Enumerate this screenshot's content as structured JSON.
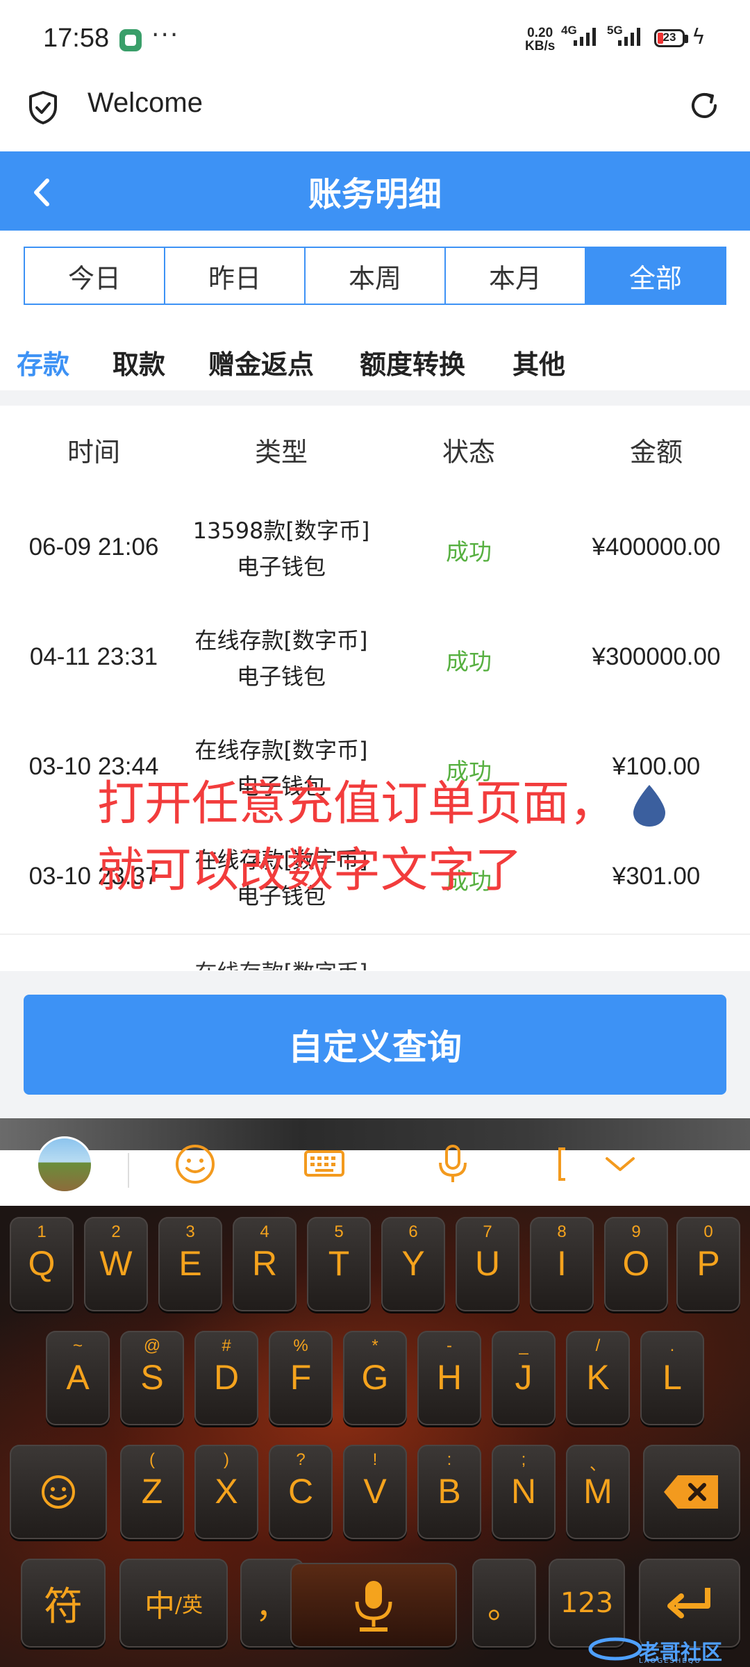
{
  "status_bar": {
    "time": "17:58",
    "speed_top": "0.20",
    "speed_bottom": "KB/s",
    "net1": "4G",
    "net2": "5G",
    "battery": "23"
  },
  "browser": {
    "title": "Welcome",
    "icons": {
      "shield": "shield-check-icon",
      "reload": "reload-icon"
    }
  },
  "page": {
    "title": "账务明细",
    "back_icon": "chevron-left-icon"
  },
  "periods": [
    {
      "label": "今日",
      "active": false
    },
    {
      "label": "昨日",
      "active": false
    },
    {
      "label": "本周",
      "active": false
    },
    {
      "label": "本月",
      "active": false
    },
    {
      "label": "全部",
      "active": true
    }
  ],
  "categories": [
    {
      "label": "存款",
      "active": true
    },
    {
      "label": "取款",
      "active": false
    },
    {
      "label": "赠金返点",
      "active": false
    },
    {
      "label": "额度转换",
      "active": false
    },
    {
      "label": "其他",
      "active": false
    }
  ],
  "table": {
    "headers": [
      "时间",
      "类型",
      "状态",
      "金额"
    ],
    "rows": [
      {
        "time": "06-09 21:06",
        "type_line1": "13598款[数字币]",
        "type_line2": "电子钱包",
        "status": "成功",
        "amount": "¥400000.00"
      },
      {
        "time": "04-11 23:31",
        "type_line1": "在线存款[数字币]",
        "type_line2": "电子钱包",
        "status": "成功",
        "amount": "¥300000.00"
      },
      {
        "time": "03-10 23:44",
        "type_line1": "在线存款[数字币]",
        "type_line2": "电子钱包",
        "status": "成功",
        "amount": "¥100.00"
      },
      {
        "time": "03-10 23:37",
        "type_line1": "在线存款[数字币]",
        "type_line2": "电子钱包",
        "status": "成功",
        "amount": "¥301.00"
      }
    ],
    "partial_row_text": "在线存款[数字币]"
  },
  "query_button": "自定义查询",
  "overlay_text": "打开任意充值订单页面，\n就可以改数字文字了",
  "colors": {
    "accent": "#3d92f5",
    "success": "#57b041",
    "overlay_red": "#f23c3c",
    "key_text": "#f5a31d"
  },
  "keyboard": {
    "toolbar_icons": [
      "emoji-icon",
      "keyboard-icon",
      "microphone-icon",
      "bracket-icon",
      "chevron-down-icon"
    ],
    "row1": [
      {
        "num": "1",
        "ch": "Q"
      },
      {
        "num": "2",
        "ch": "W"
      },
      {
        "num": "3",
        "ch": "E"
      },
      {
        "num": "4",
        "ch": "R"
      },
      {
        "num": "5",
        "ch": "T"
      },
      {
        "num": "6",
        "ch": "Y"
      },
      {
        "num": "7",
        "ch": "U"
      },
      {
        "num": "8",
        "ch": "I"
      },
      {
        "num": "9",
        "ch": "O"
      },
      {
        "num": "0",
        "ch": "P"
      }
    ],
    "row2": [
      {
        "num": "~",
        "ch": "A"
      },
      {
        "num": "@",
        "ch": "S"
      },
      {
        "num": "#",
        "ch": "D"
      },
      {
        "num": "%",
        "ch": "F"
      },
      {
        "num": "*",
        "ch": "G"
      },
      {
        "num": "-",
        "ch": "H"
      },
      {
        "num": "_",
        "ch": "J"
      },
      {
        "num": "/",
        "ch": "K"
      },
      {
        "num": ".",
        "ch": "L"
      }
    ],
    "row3": [
      {
        "num": "(",
        "ch": "Z"
      },
      {
        "num": ")",
        "ch": "X"
      },
      {
        "num": "?",
        "ch": "C"
      },
      {
        "num": "!",
        "ch": "V"
      },
      {
        "num": ":",
        "ch": "B"
      },
      {
        "num": ";",
        "ch": "N"
      },
      {
        "num": "、",
        "ch": "M"
      }
    ],
    "symbol_key": "符",
    "lang_key_main": "中",
    "lang_key_sub": "/英",
    "comma_key": "，",
    "period_key": "。",
    "num_key": "123"
  },
  "watermark": {
    "text": "老哥社区",
    "sub": "LAOGESHEQU"
  }
}
